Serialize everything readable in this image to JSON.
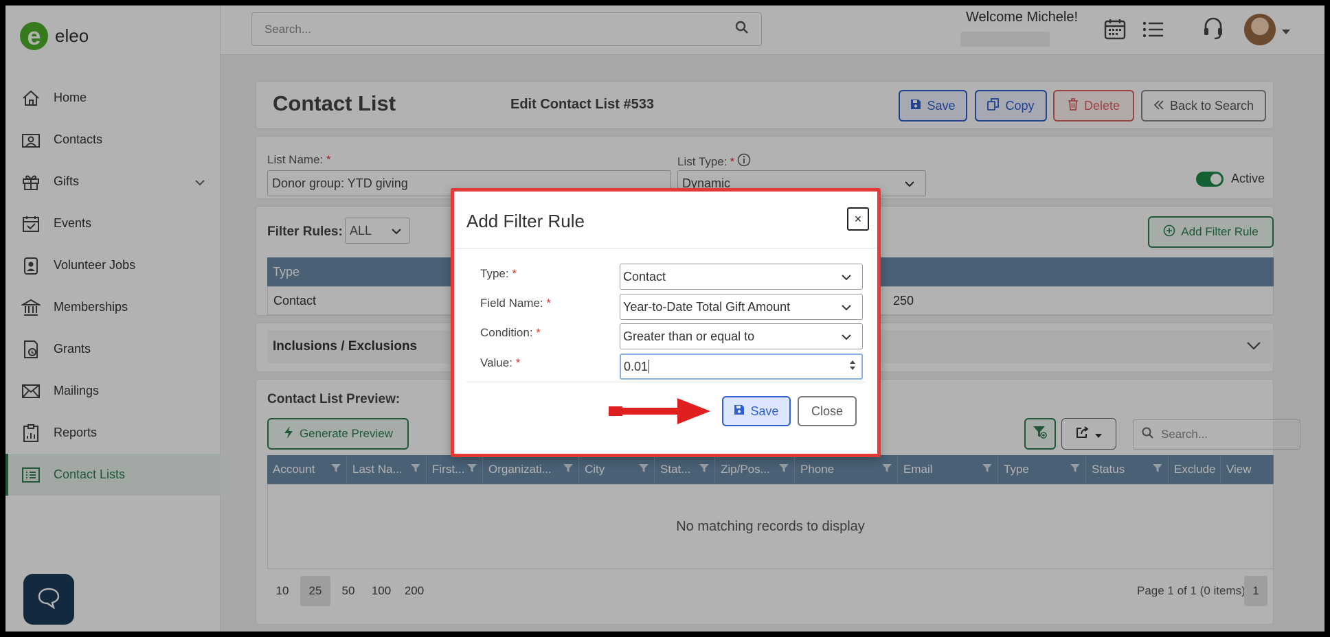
{
  "app": {
    "logo_letter": "e",
    "logo_text": "eleo"
  },
  "sidebar": {
    "items": [
      {
        "label": "Home",
        "icon": "home-icon"
      },
      {
        "label": "Contacts",
        "icon": "contacts-icon"
      },
      {
        "label": "Gifts",
        "icon": "gift-icon"
      },
      {
        "label": "Events",
        "icon": "calendar-check-icon"
      },
      {
        "label": "Volunteer Jobs",
        "icon": "badge-icon"
      },
      {
        "label": "Memberships",
        "icon": "bank-icon"
      },
      {
        "label": "Grants",
        "icon": "grant-icon"
      },
      {
        "label": "Mailings",
        "icon": "mail-icon"
      },
      {
        "label": "Reports",
        "icon": "clipboard-icon"
      },
      {
        "label": "Contact Lists",
        "icon": "list-icon"
      }
    ],
    "active": "Contact Lists"
  },
  "topbar": {
    "search_placeholder": "Search...",
    "welcome": "Welcome Michele!"
  },
  "header": {
    "title": "Contact List",
    "edit_title": "Edit Contact List #533",
    "save_label": "Save",
    "copy_label": "Copy",
    "delete_label": "Delete",
    "back_label": "Back to Search"
  },
  "form": {
    "list_name_label": "List Name:",
    "list_name_value": "Donor group: YTD giving",
    "list_type_label": "List Type:",
    "list_type_value": "Dynamic",
    "active_label": "Active",
    "required_mark": "*"
  },
  "rules": {
    "title": "Filter Rules:",
    "match_value": "ALL",
    "add_label": "Add Filter Rule",
    "column_type": "Type",
    "row_type": "Contact",
    "row_value": "250"
  },
  "inclusions": {
    "title": "Inclusions / Exclusions"
  },
  "preview": {
    "title": "Contact List Preview:",
    "generate_label": "Generate Preview",
    "search_placeholder": "Search...",
    "columns": [
      "Account",
      "Last Na...",
      "First...",
      "Organizati...",
      "City",
      "Stat...",
      "Zip/Pos...",
      "Phone",
      "Email",
      "Type",
      "Status",
      "Exclude",
      "View"
    ],
    "empty_text": "No matching records to display",
    "page_sizes": [
      "10",
      "25",
      "50",
      "100",
      "200"
    ],
    "selected_page_size": "25",
    "page_info": "Page 1 of 1 (0 items)",
    "current_page": "1"
  },
  "modal": {
    "title": "Add Filter Rule",
    "close_x": "×",
    "type_label": "Type:",
    "type_value": "Contact",
    "field_label": "Field Name:",
    "field_value": "Year-to-Date Total Gift Amount",
    "condition_label": "Condition:",
    "condition_value": "Greater than or equal to",
    "value_label": "Value:",
    "value_value": "0.01",
    "save_label": "Save",
    "close_label": "Close"
  },
  "colors": {
    "brand_green": "#2e7d4f",
    "primary_blue": "#2f5fd0",
    "danger_red": "#e06060",
    "highlight_red": "#e53935",
    "grid_header": "#6b8aa8"
  }
}
